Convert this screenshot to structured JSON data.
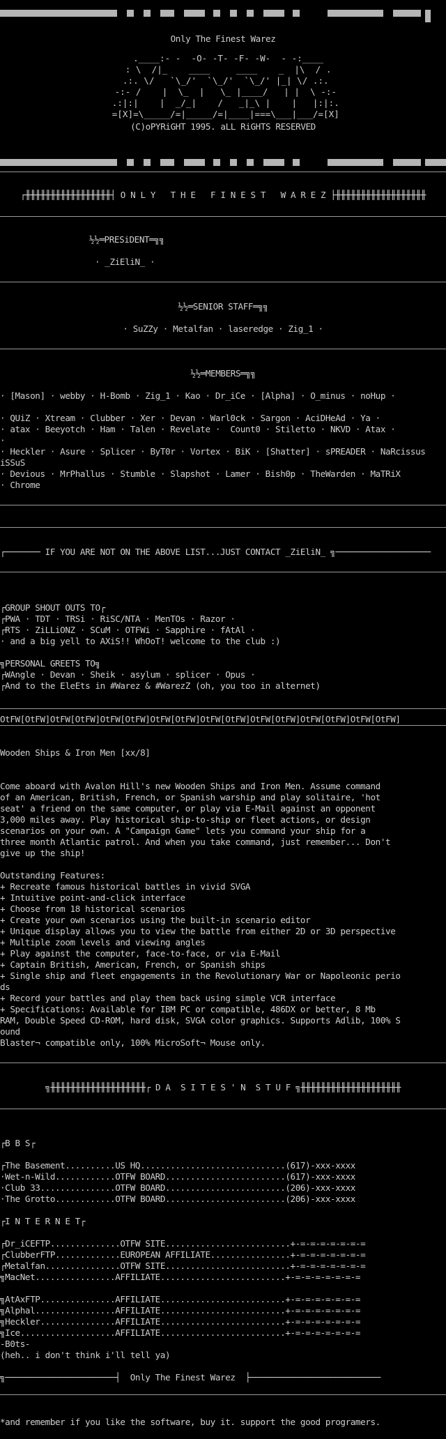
{
  "header": {
    "title": "Only The Finest Warez",
    "logo": [
      "  .____:- -  -O- -T- -F- -W-  - -:____",
      "  : \\  /|_    ____     ____    _  |\\  / .",
      " .:. \\/   `\\_/'  `\\_/'  `\\_/' |_| \\/ .:.",
      " -:- /    |  \\_  |   \\_ |____/   | |  \\ -:-",
      " .:|:|    |  _/_|    /   _|_\\ |    |   |:|:.",
      " =[X]=\\_____/=|_____/=|____|===\\___|___/=[X]"
    ],
    "copyright": "(C)oPYRiGHT 1995. aLL RiGHTS RESERVED"
  },
  "banner": {
    "ornament": "┌╫╫╫╫╫╫╫╫╫╫╫╫╫╫╫╫╫┤",
    "title": "O N L Y   T H E   F I N E S T   W A R E Z",
    "ornament_right": "├╫╫╫╫╫╫╫╫╫╫╫╫╫╫╫╫╫╫"
  },
  "president": {
    "heading": "½½═PRESiDENT═╗╗",
    "names": "· _ZiEliN_ ·"
  },
  "senior_staff": {
    "heading": "½½═SENIOR STAFF═╗╗",
    "names": "· SuZZy · Metalfan · laseredge · Zig_1 ·"
  },
  "members": {
    "heading": "½½═MEMBERS═╗╗",
    "lines": [
      "· [Mason] · webby · H-Bomb · Zig_1 · Kao · Dr_iCe · [Alpha] · O_minus · noHup ·",
      "",
      "· QUiZ · Xtream · Clubber · Xer · Devan · Warl0ck · Sargon · AciDHeAd · Ya ·",
      "· atax · Beeyotch · Ham · Talen · Revelate ·  Count0 · Stiletto · NKVD · Atax ·",
      "·",
      "· Heckler · Asure · Splicer · ByT0r · Vortex · BiK · [Shatter] · sPREADER · NaRcissus",
      "iSSuS",
      "· Devious · MrPhallus · Stumble · Slapshot · Lamer · Bish0p · TheWarden · MaTRiX",
      "· Chrome"
    ]
  },
  "contact": {
    "line": "┌─────── IF YOU ARE NOT ON THE ABOVE LIST...JUST CONTACT _ZiEliN_ ╗───────────────────"
  },
  "shoutouts": {
    "lines": [
      "┌GROUP SHOUT OUTS TO┌",
      "┌PWA · TDT · TRSi · RiSC/NTA · MenTOs · Razor ·",
      "┌RTS · ZiLLiONZ · SCuM · OTFWi · Sapphire · fAtAl ·",
      "· and a big yell to AXiS!! WhOoT! welcome to the club :)",
      "",
      "╗PERSONAL GREETS TO╗",
      "┌WAngle · Devan · Sheik · asylum · splicer · Opus ·",
      "┌And to the EleEts in #Warez & #WarezZ (oh, you too in alternet)"
    ]
  },
  "otfw_strip": "OtFW[OtFW]OtFW[OtFW]OtFW[OtFW]OtFW[OtFW]OtFW[OtFW]OtFW[OtFW]OtFW[OtFW]OtFW[OtFW]",
  "release": {
    "title": "Wooden Ships & Iron Men [xx/8]",
    "description": [
      "Come aboard with Avalon Hill's new Wooden Ships and Iron Men. Assume command",
      "of an American, British, French, or Spanish warship and play solitaire, 'hot",
      "seat' a friend on the same computer, or play via E-Mail against an opponent",
      "3,000 miles away. Play historical ship-to-ship or fleet actions, or design",
      "scenarios on your own. A \"Campaign Game\" lets you command your ship for a",
      "three month Atlantic patrol. And when you take command, just remember... Don't",
      "give up the ship!"
    ],
    "features_heading": "Outstanding Features:",
    "features": [
      "+ Recreate famous historical battles in vivid SVGA",
      "+ Intuitive point-and-click interface",
      "+ Choose from 18 historical scenarios",
      "+ Create your own scenarios using the built-in scenario editor",
      "+ Unique display allows you to view the battle from either 2D or 3D perspective",
      "+ Multiple zoom levels and viewing angles",
      "+ Play against the computer, face-to-face, or via E-Mail",
      "+ Captain British, American, French, or Spanish ships",
      "+ Single ship and fleet engagements in the Revolutionary War or Napoleonic perio",
      "ds",
      "+ Record your battles and play them back using simple VCR interface",
      "+ Specifications: Available for IBM PC or compatible, 486DX or better, 8 Mb",
      "RAM, Double Speed CD-ROM, hard disk, SVGA color graphics. Supports Adlib, 100% S",
      "ound",
      "Blaster¬ compatible only, 100% MicroSoft¬ Mouse only."
    ]
  },
  "sites_banner": {
    "ornament": "╗╫╫╫╫╫╫╫╫╫╫╫╫╫╫╫╫╫╫╫┌",
    "title": "D A  S I T E S ' N  S T U F",
    "ornament_right": "╗╫╫╫╫╫╫╫╫╫╫╫╫╫╫╫╫╫╫╫╫"
  },
  "bbs": {
    "heading": "┌B B S┌",
    "lines": [
      "┌The Basement..........US HQ.............................(617)-xxx-xxxx",
      "·Wet-n-Wild............OTFW BOARD........................(617)-xxx-xxxx",
      "·Club 33...............OTFW BOARD........................(206)-xxx-xxxx",
      "·The Grotto............OTFW BOARD........................(206)-xxx-xxxx"
    ]
  },
  "internet": {
    "heading": "┌I N T E R N E T┌",
    "lines": [
      "┌Dr_iCEFTP..............OTFW SITE.........................+-=-=-=-=-=-=-=",
      "┌ClubberFTP.............EUROPEAN AFFILIATE................+-=-=-=-=-=-=-=",
      "┌Metalfan...............OTFW SITE.........................+-=-=-=-=-=-=-=",
      "╗MacNet................AFFILIATE.........................+-=-=-=-=-=-=-=",
      "",
      "╗AtAxFTP...............AFFILIATE.........................+-=-=-=-=-=-=-=",
      "╗Alphal................AFFILIATE.........................+-=-=-=-=-=-=-=",
      "╗Heckler...............AFFILIATE.........................+-=-=-=-=-=-=-=",
      "╗Ice...................AFFILIATE.........................+-=-=-=-=-=-=-=",
      "-B0ts-",
      "(heh.. i don't think i'll tell ya)"
    ]
  },
  "footer": {
    "banner": "╗──────────────────────┤  Only The Finest Warez  ├──────────────────────────",
    "closing": "*and remember if you like the software, buy it. support the good programers."
  }
}
